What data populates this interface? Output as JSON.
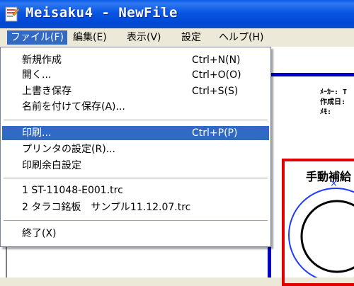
{
  "window": {
    "title": "Meisaku4 - NewFile",
    "accent": "#316ac5"
  },
  "menubar": {
    "items": [
      {
        "label": "ファイル(F)"
      },
      {
        "label": "編集(E)"
      },
      {
        "label": "表示(V)"
      },
      {
        "label": "設定"
      },
      {
        "label": "ヘルプ(H)"
      }
    ]
  },
  "file_menu": {
    "items": [
      {
        "label": "新規作成",
        "shortcut": "Ctrl+N(N)"
      },
      {
        "label": "開く...",
        "shortcut": "Ctrl+O(O)"
      },
      {
        "label": "上書き保存",
        "shortcut": "Ctrl+S(S)"
      },
      {
        "label": "名前を付けて保存(A)..."
      },
      {
        "label": "印刷...",
        "shortcut": "Ctrl+P(P)"
      },
      {
        "label": "プリンタの設定(R)..."
      },
      {
        "label": "印刷余白設定"
      },
      {
        "label": "1 ST-11048-E001.trc"
      },
      {
        "label": "2 タラコ銘板　サンプル11.12.07.trc"
      },
      {
        "label": "終了(X)"
      }
    ]
  },
  "document": {
    "labels": [
      "ﾒｰｶｰ: T",
      "作成日:",
      "ﾒﾓ:"
    ],
    "section_title": "手動補給"
  }
}
